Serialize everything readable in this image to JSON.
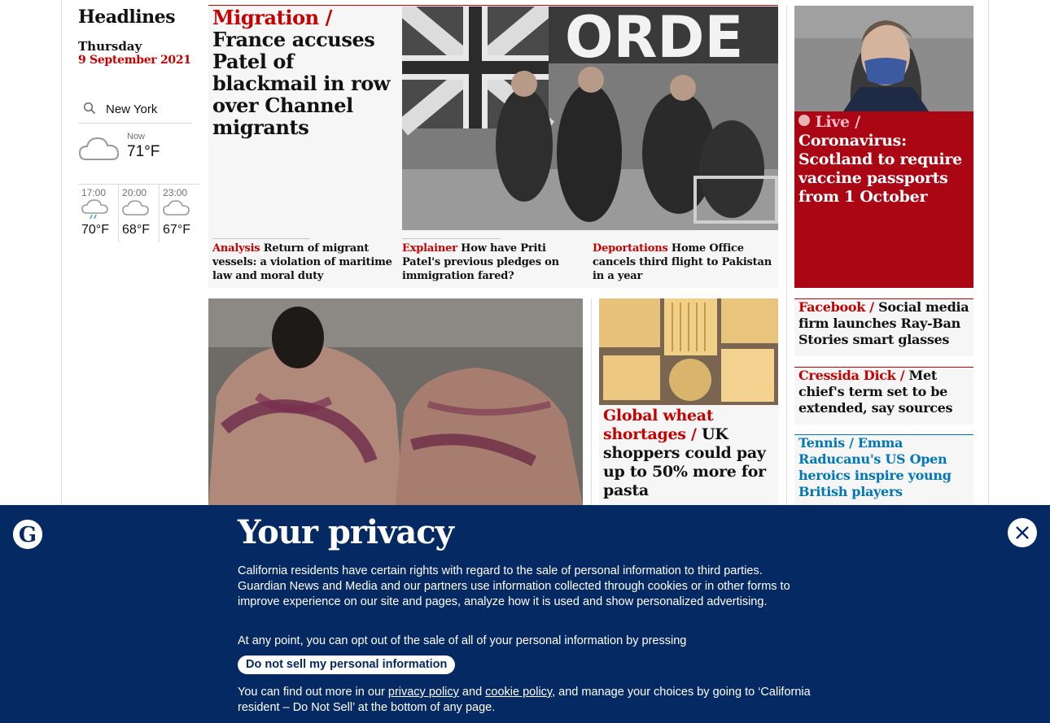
{
  "rail": {
    "title": "Headlines",
    "day": "Thursday",
    "date": "9 September 2021",
    "location": "New York",
    "now_label": "Now",
    "now_temp": "71°F",
    "forecast": [
      {
        "time": "17:00",
        "temp": "70°F",
        "icon": "rain-cloud-icon"
      },
      {
        "time": "20:00",
        "temp": "68°F",
        "icon": "cloud-icon"
      },
      {
        "time": "23:00",
        "temp": "67°F",
        "icon": "cloud-icon"
      }
    ]
  },
  "lead": {
    "kicker": "Migration /",
    "headline": "France accuses Patel of blackmail in row over Channel migrants",
    "image_alt": "Border Force officers carry a child from a boat"
  },
  "sublinks": [
    {
      "kicker": "Analysis",
      "text": "Return of migrant vessels: a violation of maritime law and moral duty"
    },
    {
      "kicker": "Explainer",
      "text": "How have Priti Patel's previous pledges on immigration fared?"
    },
    {
      "kicker": "Deportations",
      "text": "Home Office cancels third flight to Pakistan in a year"
    }
  ],
  "live": {
    "badge": "Live /",
    "headline": "Coronavirus: Scotland to require vaccine passports from 1 October"
  },
  "side_stories": [
    {
      "kicker": "Facebook /",
      "text": "Social media firm launches Ray-Ban Stories smart glasses"
    },
    {
      "kicker": "Cressida Dick /",
      "text": "Met chief's term set to be extended, say sources"
    },
    {
      "kicker": "Tennis /",
      "text": "Emma Raducanu's US Open heroics inspire young British players"
    }
  ],
  "wheat": {
    "kicker": "Global wheat shortages /",
    "headline": "UK shoppers could pay up to 50% more for pasta"
  },
  "privacy": {
    "title": "Your privacy",
    "para1": "California residents have certain rights with regard to the sale of personal information to third parties. Guardian News and Media and our partners use information collected through cookies or in other forms to improve experience on our site and pages, analyze how it is used and show personalized advertising.",
    "para2": "At any point, you can opt out of the sale of all of your personal information by pressing",
    "button": "Do not sell my personal information",
    "para3_a": "You can find out more in our ",
    "link_privacy": "privacy policy",
    "para3_b": " and ",
    "link_cookie": "cookie policy",
    "para3_c": ", and manage your choices by going to ‘California resident – Do Not Sell’ at the bottom of any page."
  },
  "colors": {
    "news_red": "#c70000",
    "brand_blue": "#052962",
    "tennis_blue": "#0077b6"
  }
}
